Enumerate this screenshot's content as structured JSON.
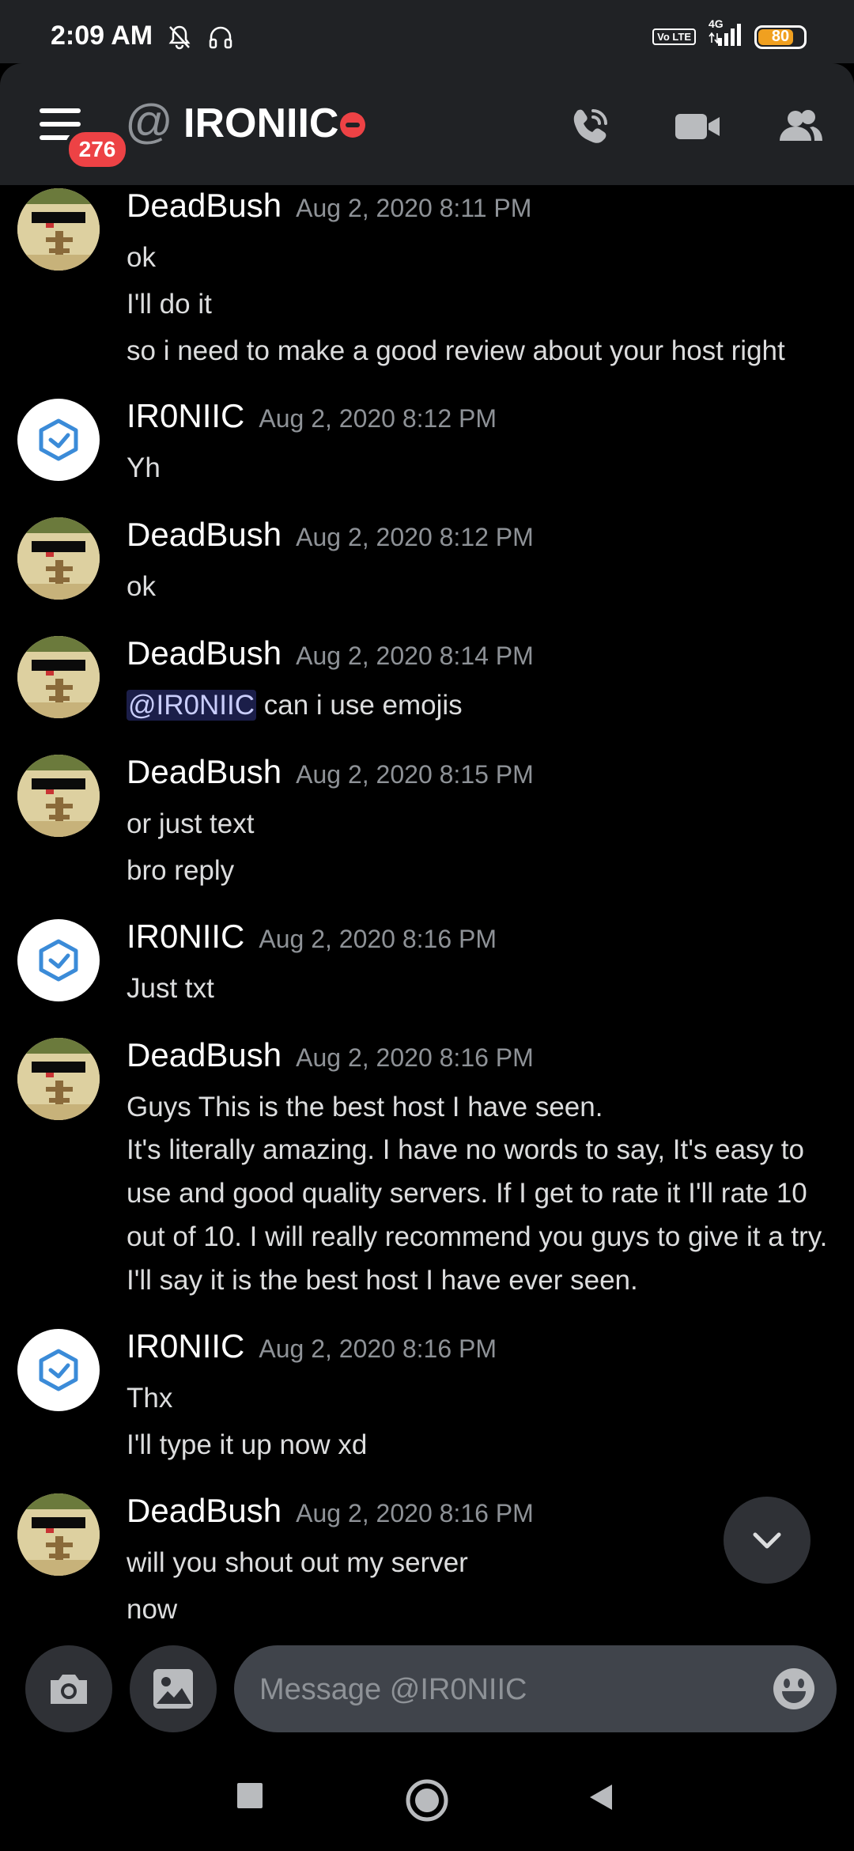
{
  "status_bar": {
    "time": "2:09 AM",
    "network": "4G",
    "volte": "Vo LTE",
    "battery": "80",
    "battery_level": 0.8
  },
  "header": {
    "menu_badge": "276",
    "channel_prefix": "@",
    "channel_name": "IRONIIC"
  },
  "messages": [
    {
      "author": "DeadBush",
      "timestamp": "Aug 2, 2020 8:11 PM",
      "lines": [
        "ok",
        "I'll do it",
        "so i need to make a good review about your host right"
      ]
    },
    {
      "author": "IR0NIIC",
      "timestamp": "Aug 2, 2020 8:12 PM",
      "lines": [
        "Yh"
      ]
    },
    {
      "author": "DeadBush",
      "timestamp": "Aug 2, 2020 8:12 PM",
      "lines": [
        "ok"
      ]
    },
    {
      "author": "DeadBush",
      "timestamp": "Aug 2, 2020 8:14 PM",
      "mention": "@IR0NIIC",
      "lines": [
        "can i use emojis"
      ]
    },
    {
      "author": "DeadBush",
      "timestamp": "Aug 2, 2020 8:15 PM",
      "lines": [
        "or just text",
        "bro reply"
      ]
    },
    {
      "author": "IR0NIIC",
      "timestamp": "Aug 2, 2020 8:16 PM",
      "lines": [
        "Just txt"
      ]
    },
    {
      "author": "DeadBush",
      "timestamp": "Aug 2, 2020 8:16 PM",
      "lines": [
        "Guys This is the best host I have seen.",
        "It's literally amazing. I have no words to say, It's easy to use and good quality servers. If I get to rate it I'll rate 10 out of 10. I will really recommend you guys to give it a try. I'll say it is the best host I have ever seen."
      ]
    },
    {
      "author": "IR0NIIC",
      "timestamp": "Aug 2, 2020 8:16 PM",
      "lines": [
        "Thx",
        "I'll type it up now xd"
      ]
    },
    {
      "author": "DeadBush",
      "timestamp": "Aug 2, 2020 8:16 PM",
      "lines": [
        "will you shout out my server",
        "now"
      ]
    }
  ],
  "composer": {
    "placeholder": "Message @IR0NIIC"
  },
  "colors": {
    "background": "#000000",
    "header": "#202225",
    "badge": "#ed4245",
    "mention_text": "#c9cdfb",
    "ironiic_logo": "#3b8bd8",
    "battery": "#f0a020"
  }
}
